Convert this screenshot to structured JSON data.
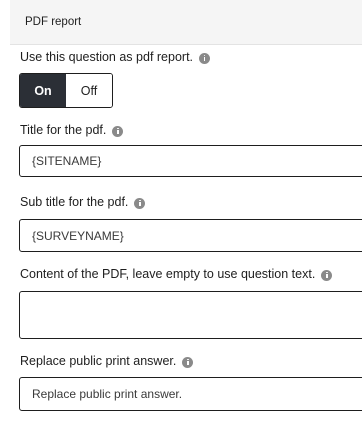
{
  "header": {
    "title": "PDF report"
  },
  "use_as_pdf": {
    "label": "Use this question as pdf report.",
    "on_label": "On",
    "off_label": "Off",
    "selected": "On"
  },
  "title_field": {
    "label": "Title for the pdf.",
    "value": "{SITENAME}"
  },
  "subtitle_field": {
    "label": "Sub title for the pdf.",
    "value": "{SURVEYNAME}"
  },
  "content_field": {
    "label": "Content of the PDF, leave empty to use question text.",
    "value": ""
  },
  "replace_field": {
    "label": "Replace public print answer.",
    "value": "Replace public print answer."
  }
}
